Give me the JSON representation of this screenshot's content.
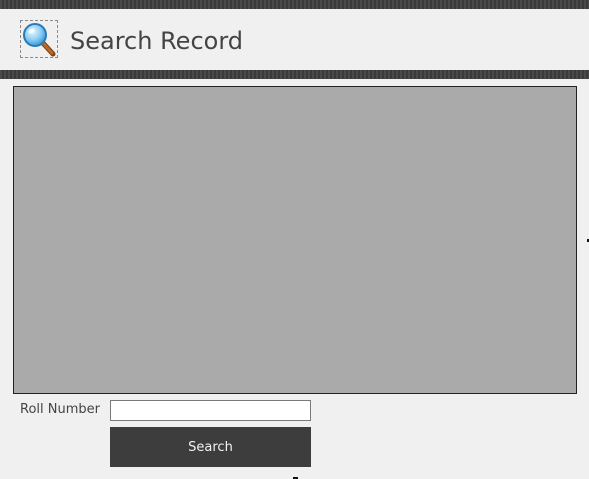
{
  "header": {
    "title": "Search Record",
    "icon": "magnifier-icon"
  },
  "form": {
    "roll_label": "Roll Number",
    "roll_value": "",
    "roll_placeholder": "",
    "search_label": "Search"
  },
  "colors": {
    "background": "#f0f0f0",
    "stripe": "#444444",
    "panel": "#aaaaaa",
    "button": "#3d3d3d",
    "button_text": "#f2f2f2",
    "title_text": "#444444"
  }
}
